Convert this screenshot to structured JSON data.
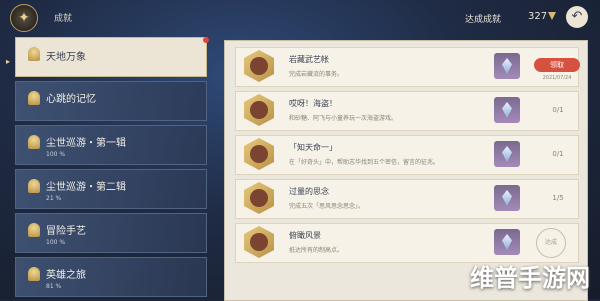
{
  "header": {
    "title": "成就",
    "count_label": "达成成就",
    "count_value": "327",
    "back_icon": "back-arrow-icon",
    "emblem_icon": "achievement-emblem-icon"
  },
  "sidebar": {
    "items": [
      {
        "name": "天地万象",
        "progress": ""
      },
      {
        "name": "心跳的记忆",
        "progress": ""
      },
      {
        "name": "尘世巡游・第一辑",
        "progress": "100 %"
      },
      {
        "name": "尘世巡游・第二辑",
        "progress": "21 %"
      },
      {
        "name": "冒险手艺",
        "progress": "100 %"
      },
      {
        "name": "英雄之旅",
        "progress": "81 %"
      }
    ]
  },
  "list": {
    "rows": [
      {
        "title": "岩藏武艺帐",
        "desc": "完成岩藏流的事务。",
        "status": "领取",
        "date": "2021/07/24",
        "progress": ""
      },
      {
        "title": "哎呀！海盗！",
        "desc": "和砂糖、阿飞与小童养玩一次海盗游戏。",
        "status": "",
        "date": "",
        "progress": "0/1"
      },
      {
        "title": "「知天命一」",
        "desc": "在「好奇头」中，帮助志华找到五个密信，留言的征兆。",
        "status": "",
        "date": "",
        "progress": "0/1"
      },
      {
        "title": "过量的思念",
        "desc": "完成五次「思风思念思念」。",
        "status": "",
        "date": "",
        "progress": "1/5"
      },
      {
        "title": "俯瞰风景",
        "desc": "抵达所有的制高点。",
        "status": "达成",
        "date": "",
        "progress": ""
      }
    ]
  },
  "watermark": "维普手游网"
}
